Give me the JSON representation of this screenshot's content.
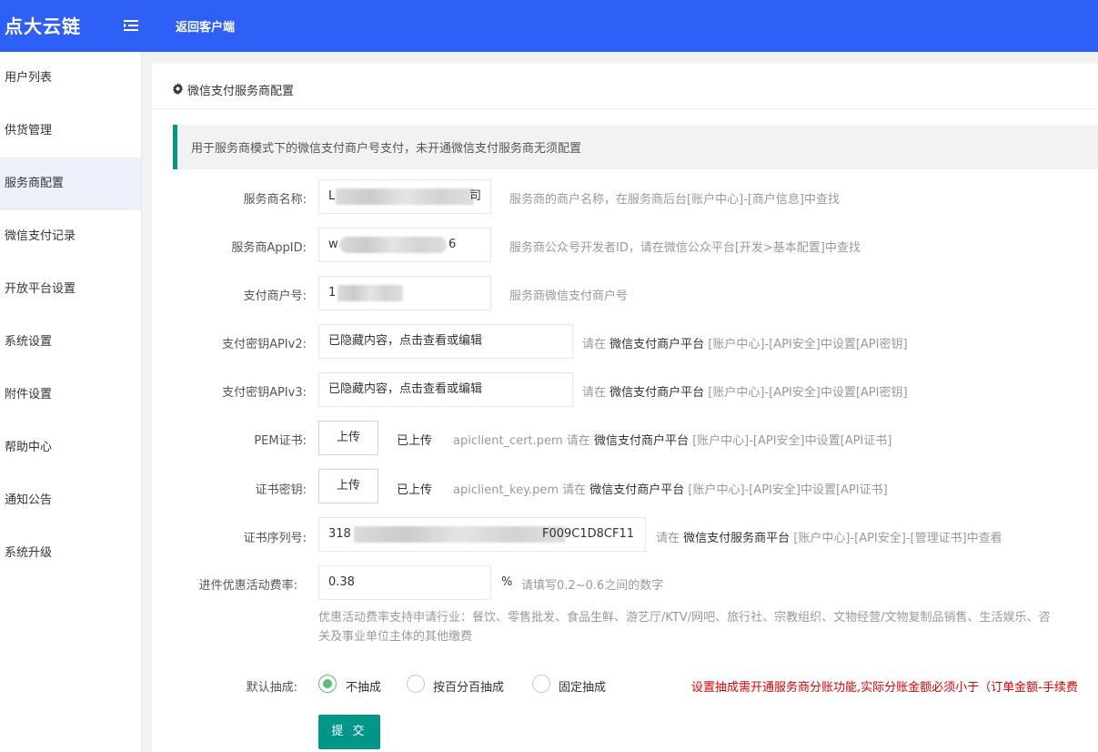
{
  "app": {
    "logo": "点大云链",
    "back_label": "返回客户端"
  },
  "colors": {
    "topbar": "#2e5ff6",
    "accent": "#009688",
    "warn": "#e30000",
    "radio": "#5FB878"
  },
  "sidebar": {
    "items": [
      {
        "label": "用户列表"
      },
      {
        "label": "供货管理"
      },
      {
        "label": "服务商配置"
      },
      {
        "label": "微信支付记录"
      },
      {
        "label": "开放平台设置"
      },
      {
        "label": "系统设置"
      },
      {
        "label": "附件设置"
      },
      {
        "label": "帮助中心"
      },
      {
        "label": "通知公告"
      },
      {
        "label": "系统升级"
      }
    ]
  },
  "page": {
    "title": "微信支付服务商配置",
    "notice": "用于服务商模式下的微信支付商户号支付，未开通微信支付服务商无须配置"
  },
  "form": {
    "name": {
      "label": "服务商名称:",
      "value_start": "L",
      "value_end": "司",
      "hint": "服务商的商户名称，在服务商后台[账户中心]-[商户信息]中查找"
    },
    "appid": {
      "label": "服务商AppID:",
      "value_start": "w",
      "value_end": "6",
      "hint": "服务商公众号开发者ID，请在微信公众平台[开发>基本配置]中查找"
    },
    "mchid": {
      "label": "支付商户号:",
      "value_start": "1",
      "hint": "服务商微信支付商户号"
    },
    "apiv2": {
      "label": "支付密钥APIv2:",
      "value": "已隐藏内容，点击查看或编辑",
      "hint_pre": "请在 ",
      "hint_bold": "微信支付商户平台",
      "hint_post": " [账户中心]-[API安全]中设置[API密钥]"
    },
    "apiv3": {
      "label": "支付密钥APIv3:",
      "value": "已隐藏内容，点击查看或编辑",
      "hint_pre": "请在 ",
      "hint_bold": "微信支付商户平台",
      "hint_post": " [账户中心]-[API安全]中设置[API密钥]"
    },
    "pem": {
      "label": "PEM证书:",
      "button": "上传",
      "status": "已上传",
      "hint_pre": "apiclient_cert.pem 请在 ",
      "hint_bold": "微信支付商户平台",
      "hint_post": " [账户中心]-[API安全]中设置[API证书]"
    },
    "key": {
      "label": "证书密钥:",
      "button": "上传",
      "status": "已上传",
      "hint_pre": "apiclient_key.pem 请在 ",
      "hint_bold": "微信支付商户平台",
      "hint_post": " [账户中心]-[API安全]中设置[API证书]"
    },
    "serial": {
      "label": "证书序列号:",
      "value_start": "318",
      "value_end": "F009C1D8CF11",
      "hint_pre": "请在 ",
      "hint_bold": "微信支付服务商平台",
      "hint_post": " [账户中心]-[API安全]-[管理证书]中查看"
    },
    "rate": {
      "label": "进件优惠活动费率:",
      "value": "0.38",
      "unit": "%",
      "hint": "请填写0.2~0.6之间的数字"
    },
    "note_line1": "优惠活动费率支持申请行业：餐饮、零售批发、食品生鲜、游艺厅/KTV/网吧、旅行社、宗教组织、文物经营/文物复制品销售、生活娱乐、咨",
    "note_line2": "关及事业单位主体的其他缴费",
    "commission": {
      "label": "默认抽成:",
      "options": [
        "不抽成",
        "按百分百抽成",
        "固定抽成"
      ],
      "selected": "不抽成",
      "warning": "设置抽成需开通服务商分账功能,实际分账金额必须小于（订单金额-手续费"
    },
    "submit": "提 交"
  }
}
